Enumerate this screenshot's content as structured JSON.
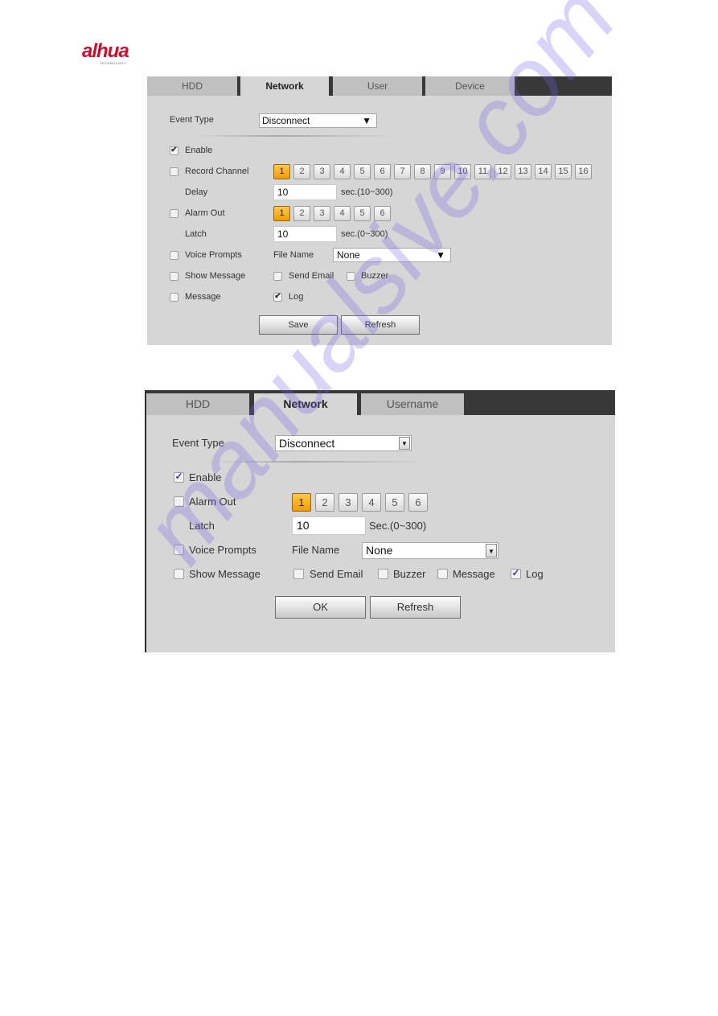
{
  "logo": {
    "brand": "alhua",
    "tagline": "TECHNOLOGY"
  },
  "watermark": "manualsive.com",
  "panel1": {
    "tabs": [
      {
        "label": "HDD",
        "active": false
      },
      {
        "label": "Network",
        "active": true
      },
      {
        "label": "User",
        "active": false
      },
      {
        "label": "Device",
        "active": false
      }
    ],
    "event_type": {
      "label": "Event Type",
      "value": "Disconnect"
    },
    "enable": {
      "label": "Enable",
      "checked": true
    },
    "record_channel": {
      "label": "Record Channel",
      "checked": false,
      "channels": [
        "1",
        "2",
        "3",
        "4",
        "5",
        "6",
        "7",
        "8",
        "9",
        "10",
        "11",
        "12",
        "13",
        "14",
        "15",
        "16"
      ],
      "selected": "1"
    },
    "delay": {
      "label": "Delay",
      "value": "10",
      "hint": "sec.(10~300)"
    },
    "alarm_out": {
      "label": "Alarm Out",
      "checked": false,
      "channels": [
        "1",
        "2",
        "3",
        "4",
        "5",
        "6"
      ],
      "selected": "1"
    },
    "latch": {
      "label": "Latch",
      "value": "10",
      "hint": "sec.(0~300)"
    },
    "voice_prompts": {
      "label": "Voice Prompts",
      "checked": false,
      "file_name_label": "File Name",
      "file_name_value": "None"
    },
    "show_message": {
      "label": "Show Message",
      "checked": false
    },
    "send_email": {
      "label": "Send Email",
      "checked": false
    },
    "buzzer": {
      "label": "Buzzer",
      "checked": false
    },
    "message": {
      "label": "Message",
      "checked": false
    },
    "log": {
      "label": "Log",
      "checked": true
    },
    "buttons": {
      "save": "Save",
      "refresh": "Refresh"
    }
  },
  "panel2": {
    "tabs": [
      {
        "label": "HDD",
        "active": false
      },
      {
        "label": "Network",
        "active": true
      },
      {
        "label": "Username",
        "active": false
      }
    ],
    "event_type": {
      "label": "Event Type",
      "value": "Disconnect"
    },
    "enable": {
      "label": "Enable",
      "checked": true
    },
    "alarm_out": {
      "label": "Alarm Out",
      "checked": false,
      "channels": [
        "1",
        "2",
        "3",
        "4",
        "5",
        "6"
      ],
      "selected": "1"
    },
    "latch": {
      "label": "Latch",
      "value": "10",
      "hint": "Sec.(0~300)"
    },
    "voice_prompts": {
      "label": "Voice Prompts",
      "checked": false,
      "file_name_label": "File Name",
      "file_name_value": "None"
    },
    "show_message": {
      "label": "Show Message",
      "checked": false
    },
    "send_email": {
      "label": "Send Email",
      "checked": false
    },
    "buzzer": {
      "label": "Buzzer",
      "checked": false
    },
    "message": {
      "label": "Message",
      "checked": false
    },
    "log": {
      "label": "Log",
      "checked": true
    },
    "buttons": {
      "ok": "OK",
      "refresh": "Refresh"
    }
  },
  "colors": {
    "accent_orange": "#f4a300",
    "tabbar_dark": "#383838",
    "panel_bg": "#d6d6d6",
    "brand_red": "#c8102e"
  }
}
